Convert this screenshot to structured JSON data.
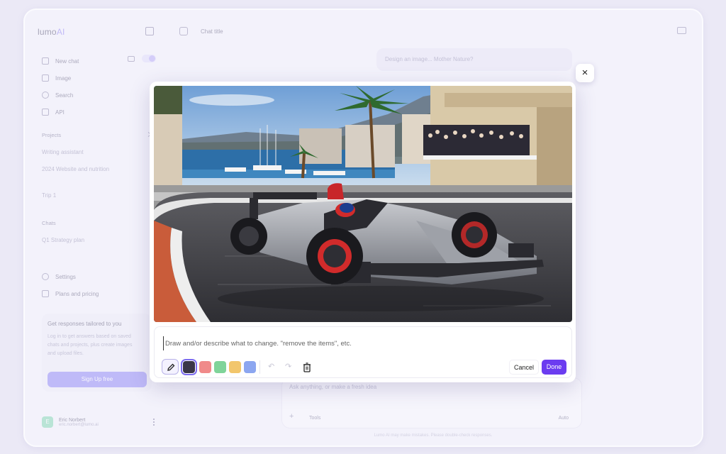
{
  "sidebar": {
    "logo_text": "lumo",
    "logo_accent": "AI",
    "nav": [
      {
        "label": "New chat",
        "icon": "edit-icon"
      },
      {
        "label": "Image",
        "icon": "image-icon"
      },
      {
        "label": "Search",
        "icon": "search-icon"
      },
      {
        "label": "API",
        "icon": "code-icon"
      }
    ],
    "projects_title": "Projects",
    "projects": [
      "Writing assistant",
      "2024 Website and nutrition",
      "Trip 1"
    ],
    "chats_title": "Chats",
    "chats": [
      "Q1 Strategy plan"
    ],
    "footer_nav": [
      {
        "label": "Settings",
        "icon": "gear-icon"
      },
      {
        "label": "Plans and pricing",
        "icon": "card-icon"
      }
    ],
    "promo": {
      "title": "Get responses tailored to you",
      "text": "Log in to get answers based on saved chats and projects, plus create images and upload files.",
      "button": "Sign Up free"
    },
    "user": {
      "initial": "E",
      "name": "Eric Norbert",
      "email": "eric.norbert@lumo.ai"
    }
  },
  "main": {
    "title": "Chat title",
    "user_message": "Design an image... Mother Nature?",
    "composer_placeholder": "Ask anything, or make a fresh idea",
    "tools_label": "Tools",
    "auto_label": "Auto",
    "disclaimer": "Lumo AI may make mistakes. Please double-check responses."
  },
  "modal": {
    "close_label": "×",
    "input_placeholder": "Draw and/or describe what to change. \"remove the items\", etc.",
    "colors": [
      "#3a3648",
      "#f08a8a",
      "#7fd49a",
      "#f2c66c",
      "#8ca6f0"
    ],
    "selected_color_index": 0,
    "undo_glyph": "↶",
    "redo_glyph": "↷",
    "cancel_label": "Cancel",
    "done_label": "Done"
  },
  "accent_colors": {
    "primary": "#6b3cf0",
    "promo_button": "#7a6ef5"
  }
}
